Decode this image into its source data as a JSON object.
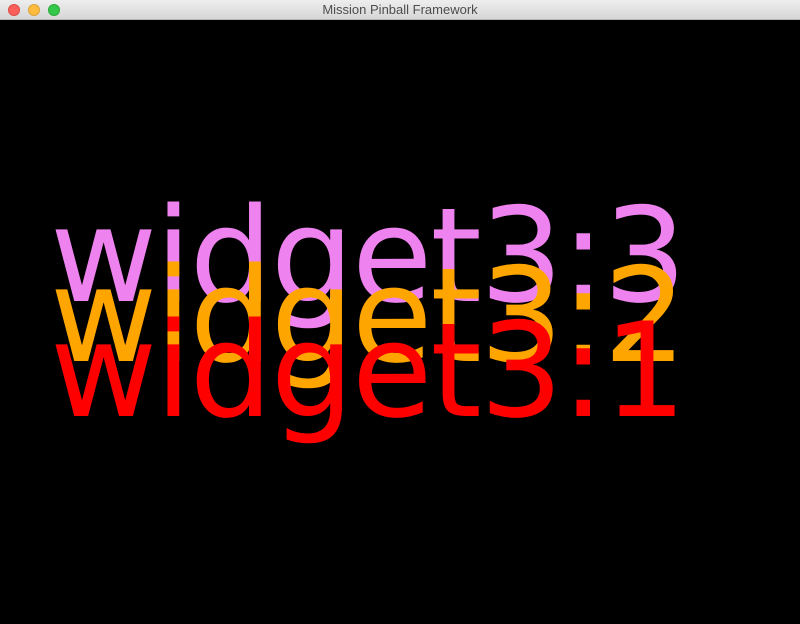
{
  "window": {
    "title": "Mission Pinball Framework"
  },
  "widgets": [
    {
      "text": "widget3:3",
      "color": "#ee82ee"
    },
    {
      "text": "widget3:2",
      "color": "#ffa500"
    },
    {
      "text": "widget3:1",
      "color": "#ff0000"
    }
  ],
  "colors": {
    "background": "#000000"
  }
}
